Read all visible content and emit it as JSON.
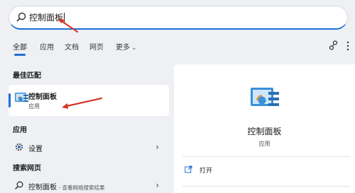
{
  "search": {
    "query": "控制面板"
  },
  "tabs": [
    {
      "label": "全部"
    },
    {
      "label": "应用"
    },
    {
      "label": "文档"
    },
    {
      "label": "网页"
    },
    {
      "label": "更多"
    }
  ],
  "sections": {
    "best_match": "最佳匹配",
    "apps": "应用",
    "web": "搜索网页"
  },
  "best_match": {
    "title": "控制面板",
    "subtitle": "应用"
  },
  "apps": [
    {
      "label": "设置"
    }
  ],
  "web_results": [
    {
      "label": "控制面板",
      "suffix": " - 查看网络搜索结果"
    }
  ],
  "detail": {
    "title": "控制面板",
    "subtitle": "应用",
    "actions": [
      {
        "label": "打开"
      }
    ]
  },
  "colors": {
    "accent": "#1f6ed4",
    "annotation": "#d9362b"
  }
}
